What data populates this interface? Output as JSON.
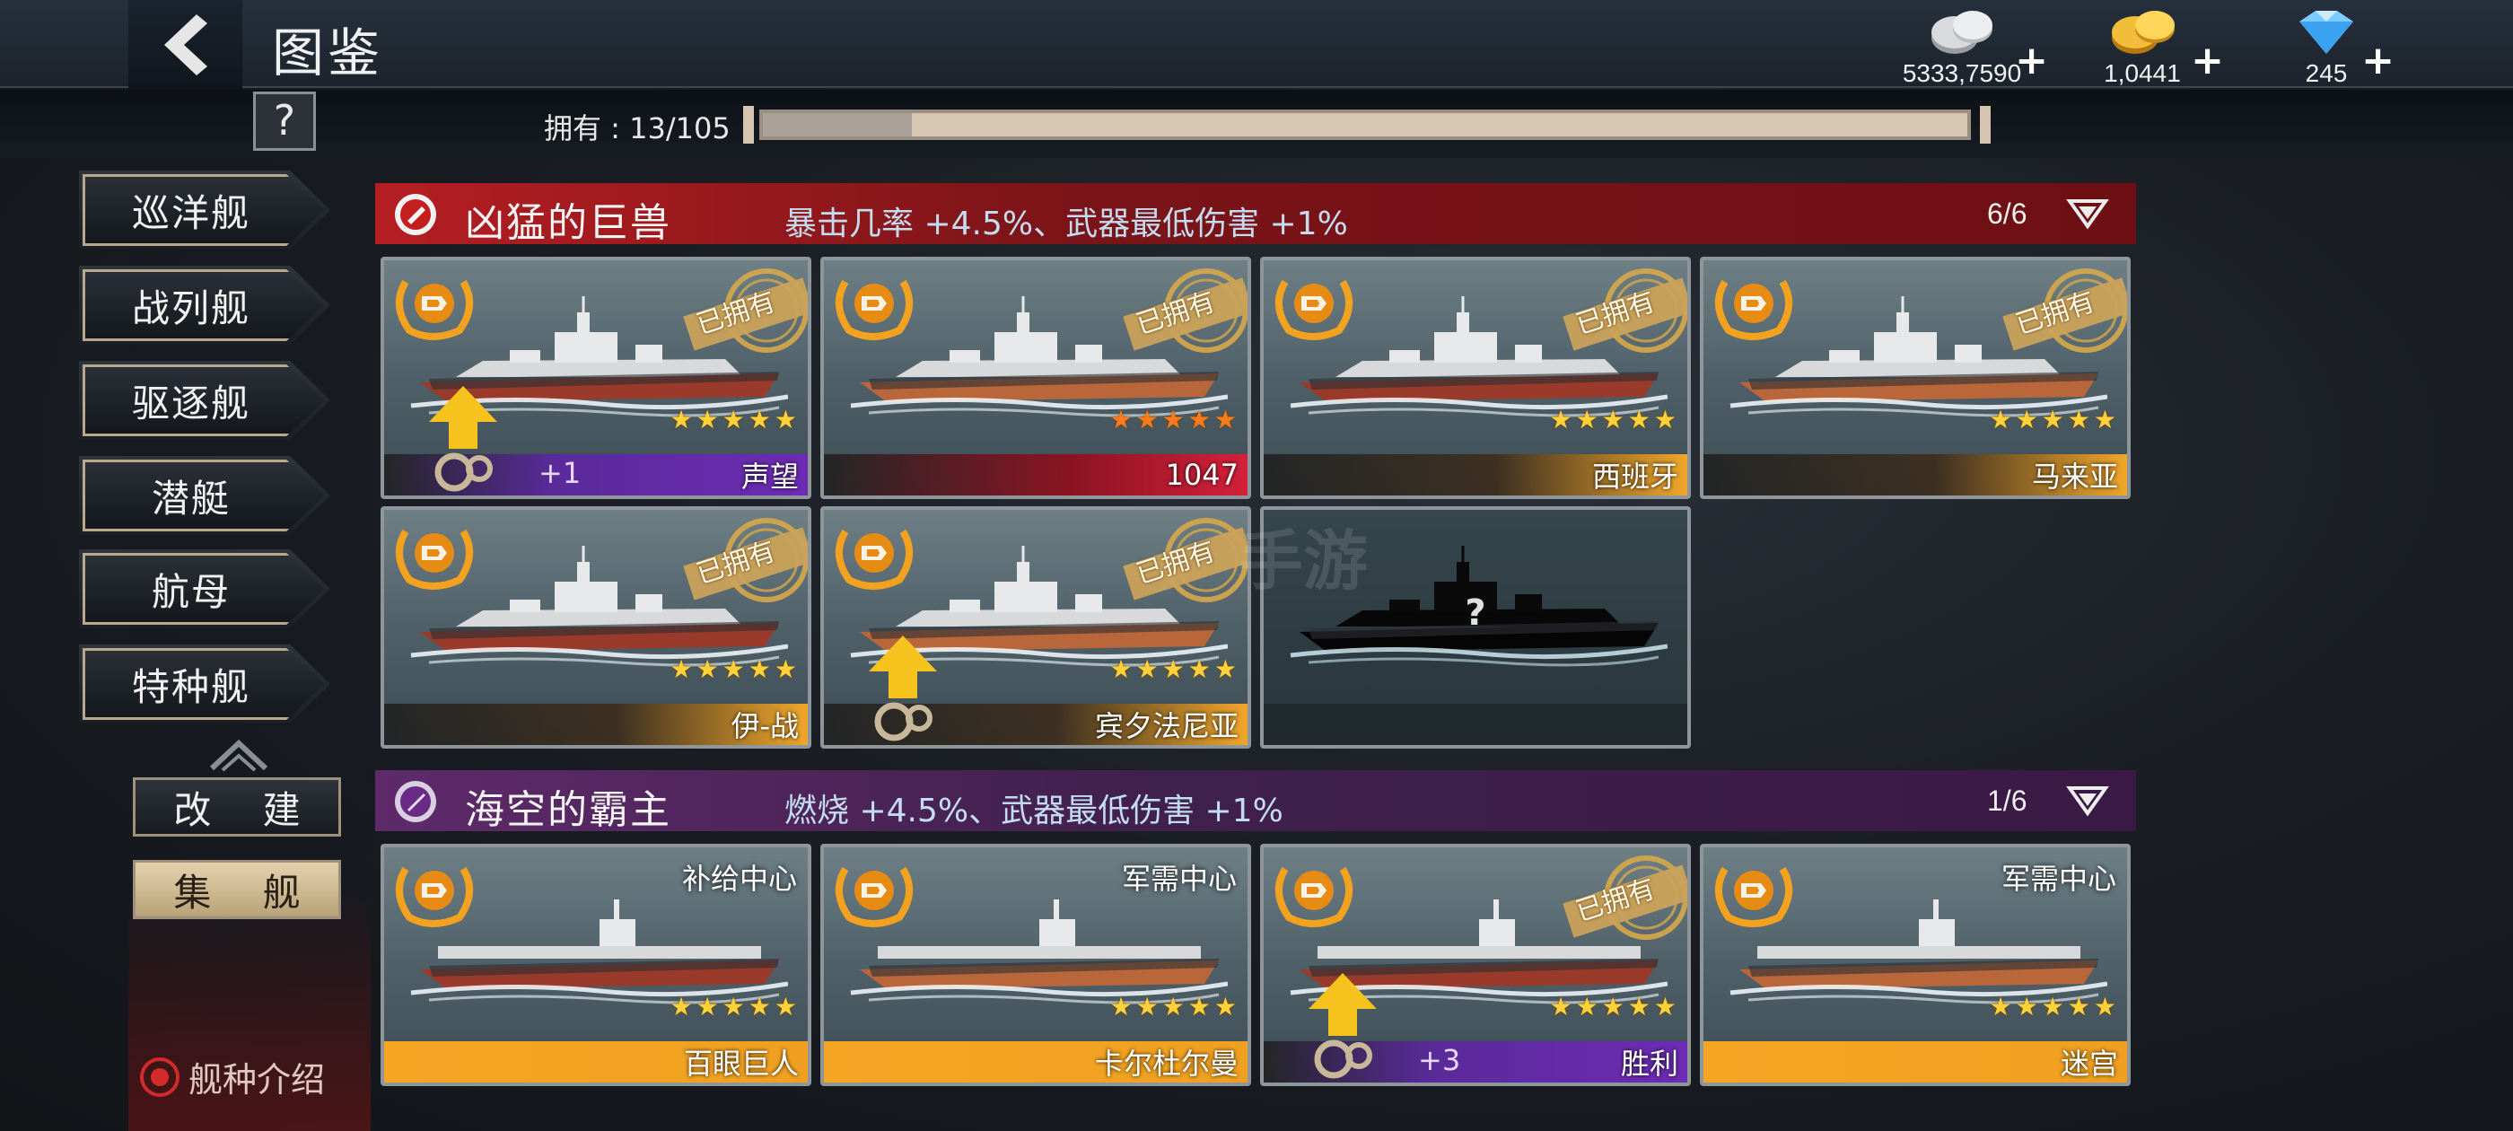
{
  "header": {
    "title": "图鉴",
    "currencies": [
      {
        "name": "silver",
        "icon": "silver-coins-icon",
        "value": "5333,7590",
        "plus": "+"
      },
      {
        "name": "gold",
        "icon": "gold-coins-icon",
        "value": "1,0441",
        "plus": "+"
      },
      {
        "name": "diamond",
        "icon": "diamond-icon",
        "value": "245",
        "plus": "+"
      }
    ]
  },
  "subbar": {
    "help": "?",
    "owned_label": "拥有 : 13/105",
    "owned_count": 13,
    "owned_total": 105
  },
  "nav": {
    "items": [
      "巡洋舰",
      "战列舰",
      "驱逐舰",
      "潜艇",
      "航母",
      "特种舰"
    ],
    "rebuild": "改 建",
    "collect": "集 舰",
    "ship_intro": "舰种介绍"
  },
  "sections": [
    {
      "title": "凶猛的巨兽",
      "bonus": "暴击几率 +4.5%、武器最低伤害 +1%",
      "count": "6/6",
      "cards": [
        {
          "name": "声望",
          "stars": 5,
          "owned": true,
          "owned_label": "已拥有",
          "bar": "purple",
          "plus": "+1",
          "upgrade": true
        },
        {
          "name": "1047",
          "stars": 5,
          "owned": true,
          "owned_label": "已拥有",
          "bar": "red",
          "star_color": "#ff7a1a"
        },
        {
          "name": "西班牙",
          "stars": 5,
          "owned": true,
          "owned_label": "已拥有",
          "bar": "orange"
        },
        {
          "name": "马来亚",
          "stars": 5,
          "owned": true,
          "owned_label": "已拥有",
          "bar": "orange"
        },
        {
          "name": "伊-战",
          "stars": 5,
          "owned": true,
          "owned_label": "已拥有",
          "bar": "orange"
        },
        {
          "name": "宾夕法尼亚",
          "stars": 5,
          "owned": true,
          "owned_label": "已拥有",
          "bar": "orange",
          "upgrade": true
        },
        {
          "name": "",
          "stars": 0,
          "owned": false,
          "unknown": true,
          "question": "?"
        }
      ]
    },
    {
      "title": "海空的霸主",
      "bonus": "燃烧 +4.5%、武器最低伤害 +1%",
      "count": "1/6",
      "cards": [
        {
          "name": "百眼巨人",
          "stars": 5,
          "owned": false,
          "bar": "full-orange",
          "tag": "补给中心"
        },
        {
          "name": "卡尔杜尔曼",
          "stars": 5,
          "owned": false,
          "bar": "full-orange",
          "tag": "军需中心"
        },
        {
          "name": "胜利",
          "stars": 5,
          "owned": true,
          "owned_label": "已拥有",
          "bar": "purple",
          "plus": "+3",
          "upgrade": true
        },
        {
          "name": "迷宫",
          "stars": 5,
          "owned": false,
          "bar": "full-orange",
          "tag": "军需中心"
        }
      ]
    }
  ],
  "watermark": "手游"
}
